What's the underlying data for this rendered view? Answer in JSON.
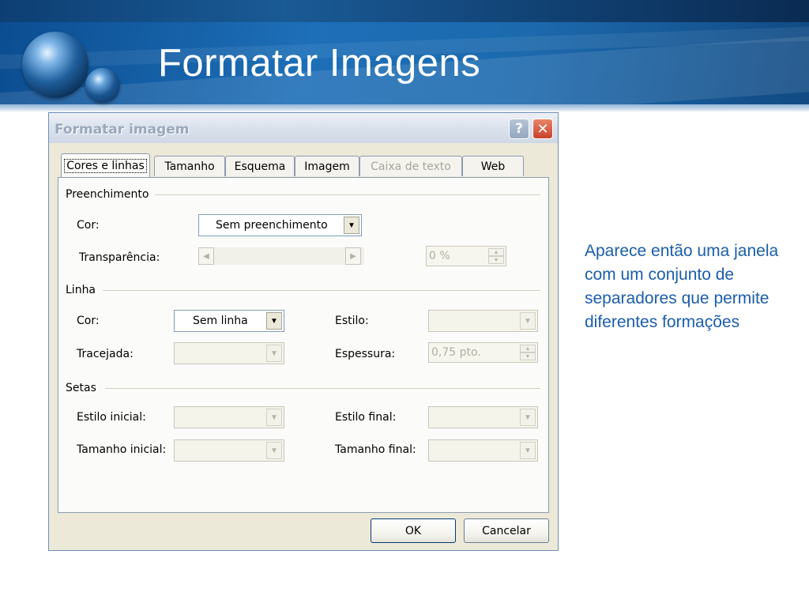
{
  "slide": {
    "title": "Formatar Imagens",
    "side_text": "Aparece então uma janela com um conjunto de separadores que permite diferentes formações"
  },
  "dialog": {
    "title": "Formatar imagem",
    "help_glyph": "?",
    "close_glyph": "✕",
    "tabs": [
      {
        "label": "Cores e linhas",
        "state": "active"
      },
      {
        "label": "Tamanho",
        "state": "normal"
      },
      {
        "label": "Esquema",
        "state": "normal"
      },
      {
        "label": "Imagem",
        "state": "normal"
      },
      {
        "label": "Caixa de texto",
        "state": "disabled"
      },
      {
        "label": "Web",
        "state": "normal"
      }
    ],
    "fill": {
      "group": "Preenchimento",
      "color_label": "Cor:",
      "color_value": "Sem preenchimento",
      "transparency_label": "Transparência:",
      "transparency_value": "0 %"
    },
    "line": {
      "group": "Linha",
      "color_label": "Cor:",
      "color_value": "Sem linha",
      "dashed_label": "Tracejada:",
      "style_label": "Estilo:",
      "weight_label": "Espessura:",
      "weight_value": "0,75 pto."
    },
    "arrows": {
      "group": "Setas",
      "begin_style_label": "Estilo inicial:",
      "begin_size_label": "Tamanho inicial:",
      "end_style_label": "Estilo final:",
      "end_size_label": "Tamanho final:"
    },
    "ok_label": "OK",
    "cancel_label": "Cancelar"
  },
  "colors": {
    "header_blue": "#1d6fb8",
    "side_text": "#1a5eac",
    "dialog_face": "#ece9d8"
  }
}
